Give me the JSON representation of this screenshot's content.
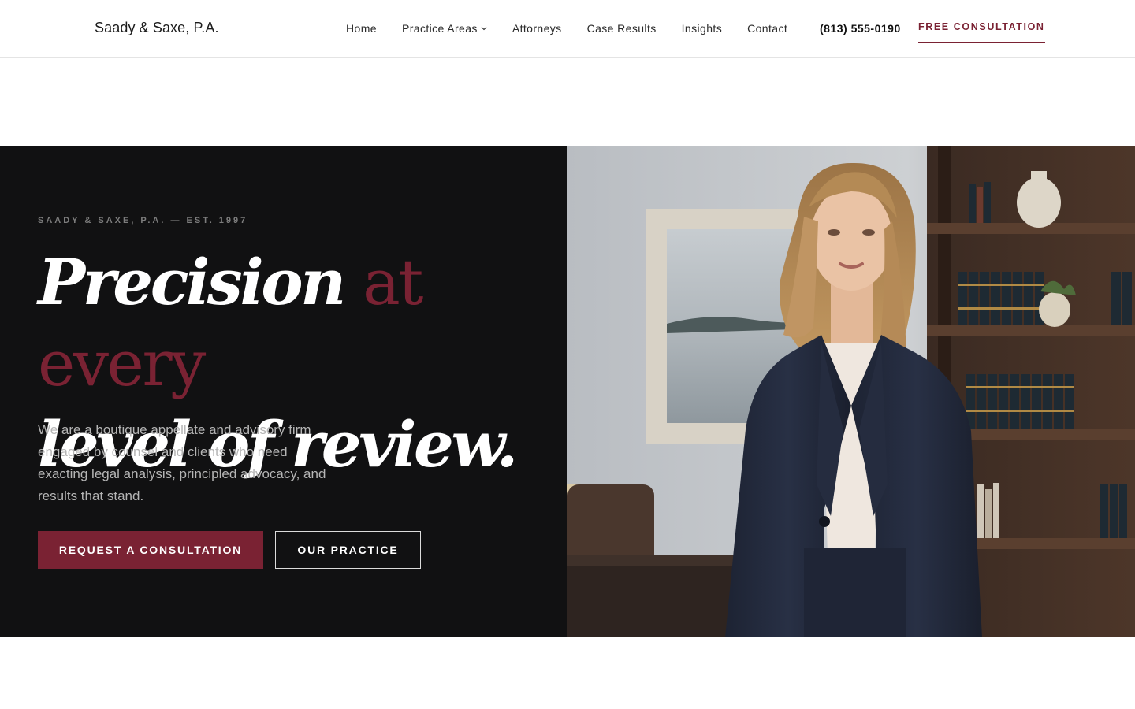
{
  "nav": {
    "brand": "Saady & Saxe, P.A.",
    "items": [
      {
        "label": "Home"
      },
      {
        "label": "Practice Areas",
        "has_dropdown": true
      },
      {
        "label": "Attorneys"
      },
      {
        "label": "Case Results"
      },
      {
        "label": "Insights"
      },
      {
        "label": "Contact"
      }
    ],
    "phone": "(813) 555-0190",
    "cta": "FREE CONSULTATION"
  },
  "hero": {
    "eyebrow": "SAADY & SAXE, P.A. — EST. 1997",
    "headline_part1": "Precision ",
    "headline_accent": "at every",
    "headline_part2": "level of review.",
    "lede": "We are a boutique appellate and advisory firm engaged by counsel and clients who need exacting legal analysis, principled advocacy, and results that stand.",
    "primary_button": "REQUEST A CONSULTATION",
    "secondary_button": "OUR PRACTICE"
  },
  "colors": {
    "accent": "#7a2233",
    "dark_panel": "#111112",
    "muted_text": "#b5b5b5"
  },
  "icons": {
    "dropdown": "chevron-down-icon"
  }
}
